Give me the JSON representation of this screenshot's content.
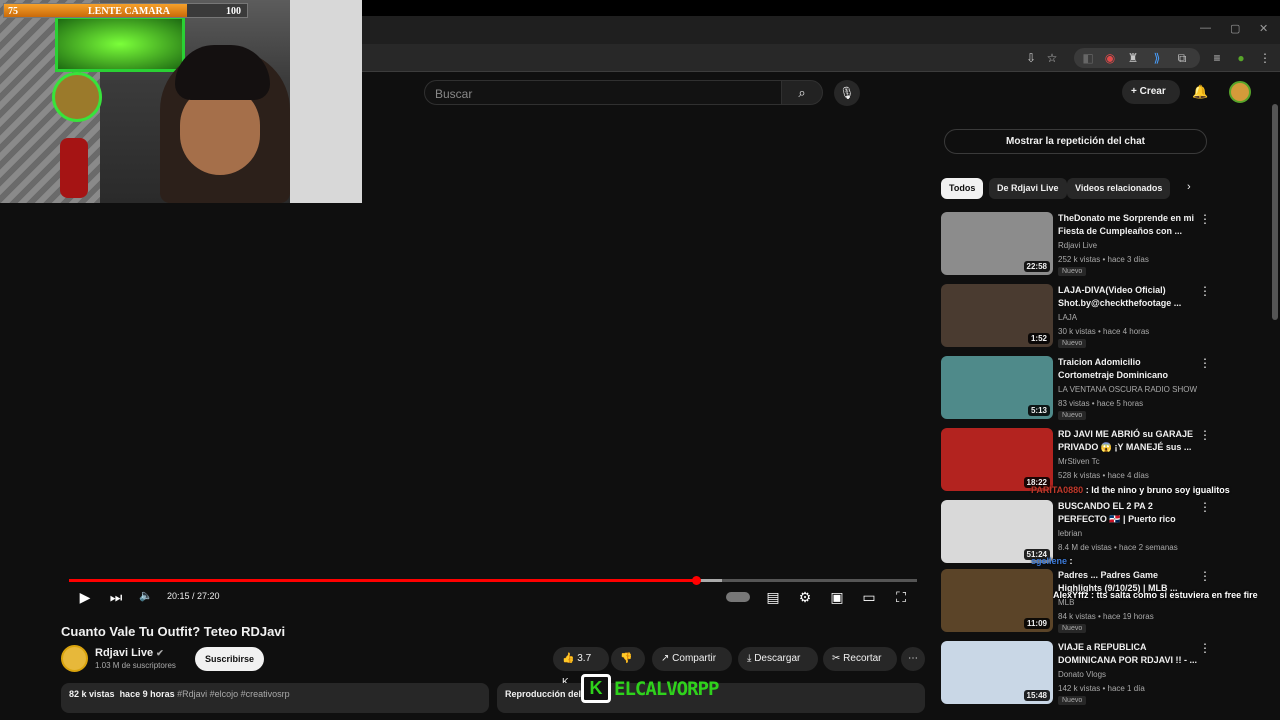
{
  "youtube": {
    "search_placeholder": "Buscar",
    "create_label": "Crear"
  },
  "webcam_overlay": {
    "bar_left": "75",
    "bar_label": "LENTE CAMARA",
    "bar_right": "100"
  },
  "player": {
    "time": "20:15 / 27:20",
    "progress_fraction": 0.74
  },
  "video": {
    "title": "Cuanto Vale Tu Outfit? Teteo RDJavi",
    "channel": "Rdjavi Live",
    "subscribers": "1.03 M de suscriptores",
    "subscribe_label": "Suscribirse",
    "likes": "3.7 K",
    "share_label": "Compartir",
    "download_label": "Descargar",
    "clip_label": "Recortar",
    "views": "82 k vistas",
    "age": "hace 9 horas",
    "tags": "#Rdjavi #elcojo #creativosrp",
    "chat_replay_box": "Reproducción del"
  },
  "overlay": {
    "logo_letter": "K",
    "brand": "ELCALVORPP"
  },
  "sidebar": {
    "chat_replay_button": "Mostrar la repetición del chat",
    "chips": [
      "Todos",
      "De Rdjavi Live",
      "Videos relacionados"
    ],
    "recs": [
      {
        "title": "TheDonato me Sorprende en mi Fiesta de Cumpleaños con ...",
        "channel": "Rdjavi Live",
        "meta": "252 k vistas • hace 3 días",
        "badge": "Nuevo",
        "duration": "22:58",
        "color": "#8c8c8c"
      },
      {
        "title": "LAJA-DIVA(Video Oficial) Shot.by@checkthefootage ...",
        "channel": "LAJA",
        "meta": "30 k vistas • hace 4 horas",
        "badge": "Nuevo",
        "duration": "1:52",
        "color": "#4a3b30"
      },
      {
        "title": "Traicion Adomicilio Cortometraje Dominicano",
        "channel": "LA VENTANA OSCURA RADIO SHOW",
        "meta": "83 vistas • hace 5 horas",
        "badge": "Nuevo",
        "duration": "5:13",
        "color": "#4f8a8a"
      },
      {
        "title": "RD JAVI ME ABRIÓ su GARAJE PRIVADO 😱 ¡Y MANEJÉ sus ...",
        "channel": "MrStiven Tc",
        "meta": "528 k vistas • hace 4 días",
        "badge": "",
        "duration": "18:22",
        "color": "#b3231f"
      },
      {
        "title": "BUSCANDO EL 2 PA 2 PERFECTO 🇩🇴 | Puerto rico",
        "channel": "lebrian",
        "meta": "8.4 M de vistas • hace 2 semanas",
        "badge": "",
        "duration": "51:24",
        "color": "#d9d9d9"
      },
      {
        "title": "Padres ... Padres Game Highlights (9/10/25) | MLB ...",
        "channel": "MLB",
        "meta": "84 k vistas • hace 19 horas",
        "badge": "Nuevo",
        "duration": "11:09",
        "color": "#5b4428"
      },
      {
        "title": "VIAJE a REPUBLICA DOMINICANA POR RDJAVI !! - ...",
        "channel": "Donato Vlogs",
        "meta": "142 k vistas • hace 1 día",
        "badge": "Nuevo",
        "duration": "15:48",
        "color": "#c9d7e6"
      }
    ]
  },
  "chat_overlay": [
    {
      "user": "PARITA0880",
      "text": ": ld the nino y bruno soy igualitos"
    },
    {
      "user": "sgellene",
      "text": ":"
    },
    {
      "user": "AlexYffz",
      "text": ": tts salta como si estuviera en free fire"
    }
  ]
}
